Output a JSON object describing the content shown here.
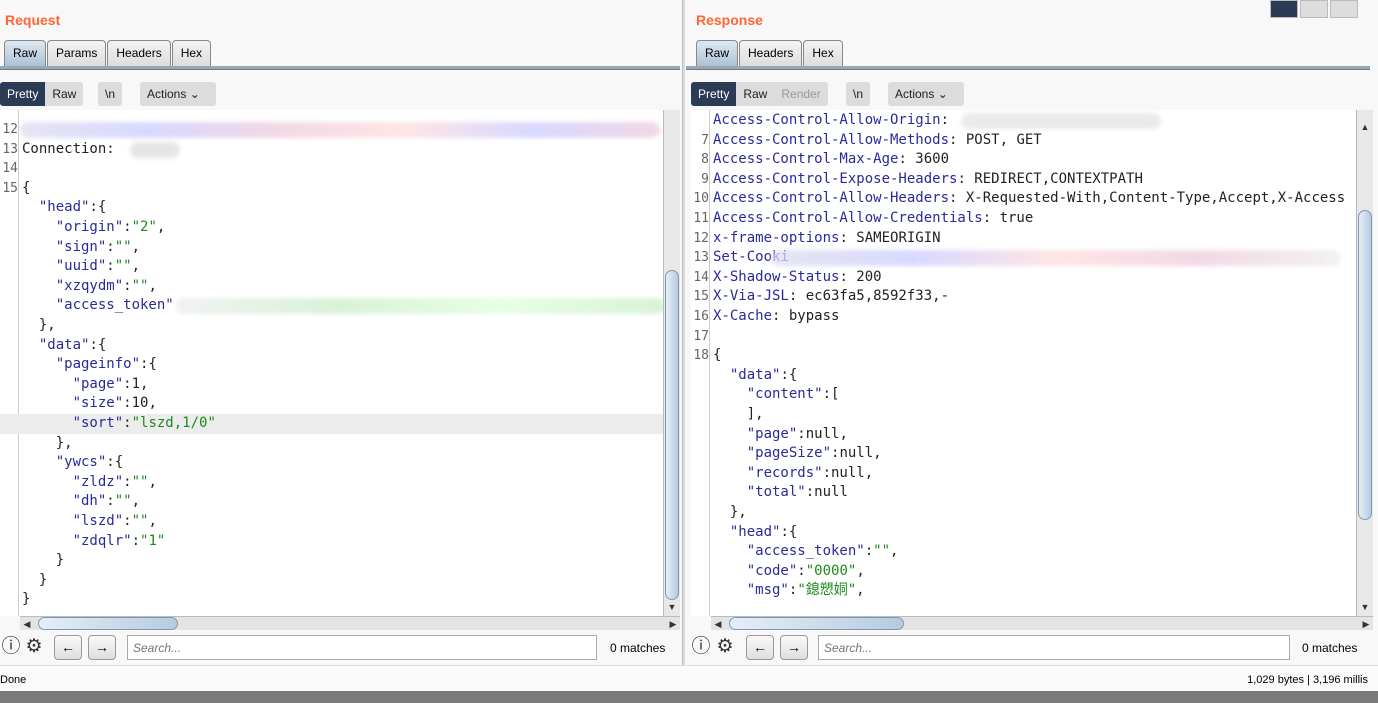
{
  "view_toggle": {
    "options": [
      "split-horizontal",
      "split-vertical",
      "tabs"
    ],
    "selected": "split-horizontal"
  },
  "request": {
    "title": "Request",
    "tabs": [
      "Raw",
      "Params",
      "Headers",
      "Hex"
    ],
    "active_tab": "Raw",
    "view_modes": [
      "Pretty",
      "Raw"
    ],
    "active_view": "Pretty",
    "newline_label": "\\n",
    "actions_label": "Actions",
    "lines": [
      {
        "n": "12",
        "segs": []
      },
      {
        "n": "13",
        "segs": [
          [
            "p",
            "Connection: "
          ]
        ]
      },
      {
        "n": "14",
        "segs": []
      },
      {
        "n": "15",
        "segs": [
          [
            "p",
            "{"
          ]
        ]
      },
      {
        "n": "",
        "segs": [
          [
            "p",
            "  "
          ],
          [
            "k",
            "\"head\""
          ],
          [
            "p",
            ":{"
          ]
        ]
      },
      {
        "n": "",
        "segs": [
          [
            "p",
            "    "
          ],
          [
            "k",
            "\"origin\""
          ],
          [
            "p",
            ":"
          ],
          [
            "s",
            "\"2\""
          ],
          [
            "p",
            ","
          ]
        ]
      },
      {
        "n": "",
        "segs": [
          [
            "p",
            "    "
          ],
          [
            "k",
            "\"sign\""
          ],
          [
            "p",
            ":"
          ],
          [
            "s",
            "\"\""
          ],
          [
            "p",
            ","
          ]
        ]
      },
      {
        "n": "",
        "segs": [
          [
            "p",
            "    "
          ],
          [
            "k",
            "\"uuid\""
          ],
          [
            "p",
            ":"
          ],
          [
            "s",
            "\"\""
          ],
          [
            "p",
            ","
          ]
        ]
      },
      {
        "n": "",
        "segs": [
          [
            "p",
            "    "
          ],
          [
            "k",
            "\"xzqydm\""
          ],
          [
            "p",
            ":"
          ],
          [
            "s",
            "\"\""
          ],
          [
            "p",
            ","
          ]
        ]
      },
      {
        "n": "",
        "segs": [
          [
            "p",
            "    "
          ],
          [
            "k",
            "\"access_token\""
          ]
        ]
      },
      {
        "n": "",
        "segs": [
          [
            "p",
            "  },"
          ]
        ]
      },
      {
        "n": "",
        "segs": [
          [
            "p",
            "  "
          ],
          [
            "k",
            "\"data\""
          ],
          [
            "p",
            ":{"
          ]
        ]
      },
      {
        "n": "",
        "segs": [
          [
            "p",
            "    "
          ],
          [
            "k",
            "\"pageinfo\""
          ],
          [
            "p",
            ":{"
          ]
        ]
      },
      {
        "n": "",
        "segs": [
          [
            "p",
            "      "
          ],
          [
            "k",
            "\"page\""
          ],
          [
            "p",
            ":1,"
          ]
        ]
      },
      {
        "n": "",
        "segs": [
          [
            "p",
            "      "
          ],
          [
            "k",
            "\"size\""
          ],
          [
            "p",
            ":10,"
          ]
        ]
      },
      {
        "n": "",
        "segs": [
          [
            "p",
            "      "
          ],
          [
            "k",
            "\"sort\""
          ],
          [
            "p",
            ":"
          ],
          [
            "s",
            "\"lszd,1/0\""
          ]
        ],
        "highlight": true
      },
      {
        "n": "",
        "segs": [
          [
            "p",
            "    },"
          ]
        ]
      },
      {
        "n": "",
        "segs": [
          [
            "p",
            "    "
          ],
          [
            "k",
            "\"ywcs\""
          ],
          [
            "p",
            ":{"
          ]
        ]
      },
      {
        "n": "",
        "segs": [
          [
            "p",
            "      "
          ],
          [
            "k",
            "\"zldz\""
          ],
          [
            "p",
            ":"
          ],
          [
            "s",
            "\"\""
          ],
          [
            "p",
            ","
          ]
        ]
      },
      {
        "n": "",
        "segs": [
          [
            "p",
            "      "
          ],
          [
            "k",
            "\"dh\""
          ],
          [
            "p",
            ":"
          ],
          [
            "s",
            "\"\""
          ],
          [
            "p",
            ","
          ]
        ]
      },
      {
        "n": "",
        "segs": [
          [
            "p",
            "      "
          ],
          [
            "k",
            "\"lszd\""
          ],
          [
            "p",
            ":"
          ],
          [
            "s",
            "\"\""
          ],
          [
            "p",
            ","
          ]
        ]
      },
      {
        "n": "",
        "segs": [
          [
            "p",
            "      "
          ],
          [
            "k",
            "\"zdqlr\""
          ],
          [
            "p",
            ":"
          ],
          [
            "s",
            "\"1\""
          ]
        ]
      },
      {
        "n": "",
        "segs": [
          [
            "p",
            "    }"
          ]
        ]
      },
      {
        "n": "",
        "segs": [
          [
            "p",
            "  }"
          ]
        ]
      },
      {
        "n": "",
        "segs": [
          [
            "p",
            "}"
          ]
        ]
      }
    ],
    "search_placeholder": "Search...",
    "matches": "0 matches"
  },
  "response": {
    "title": "Response",
    "tabs": [
      "Raw",
      "Headers",
      "Hex"
    ],
    "active_tab": "Raw",
    "view_modes": [
      "Pretty",
      "Raw",
      "Render"
    ],
    "active_view": "Pretty",
    "disabled_view": "Render",
    "newline_label": "\\n",
    "actions_label": "Actions",
    "lines": [
      {
        "n": "",
        "segs": [
          [
            "k",
            "Access-Control-Allow-Origin"
          ],
          [
            "p",
            ": "
          ]
        ]
      },
      {
        "n": "7",
        "segs": [
          [
            "k",
            "Access-Control-Allow-Methods"
          ],
          [
            "p",
            ": POST, GET"
          ]
        ]
      },
      {
        "n": "8",
        "segs": [
          [
            "k",
            "Access-Control-Max-Age"
          ],
          [
            "p",
            ": 3600"
          ]
        ]
      },
      {
        "n": "9",
        "segs": [
          [
            "k",
            "Access-Control-Expose-Headers"
          ],
          [
            "p",
            ": REDIRECT,CONTEXTPATH"
          ]
        ]
      },
      {
        "n": "10",
        "segs": [
          [
            "k",
            "Access-Control-Allow-Headers"
          ],
          [
            "p",
            ": X-Requested-With,Content-Type,Accept,X-Access"
          ]
        ]
      },
      {
        "n": "11",
        "segs": [
          [
            "k",
            "Access-Control-Allow-Credentials"
          ],
          [
            "p",
            ": true"
          ]
        ]
      },
      {
        "n": "12",
        "segs": [
          [
            "k",
            "x-frame-options"
          ],
          [
            "p",
            ": SAMEORIGIN"
          ]
        ]
      },
      {
        "n": "13",
        "segs": [
          [
            "k",
            "Set-Cooki"
          ]
        ]
      },
      {
        "n": "14",
        "segs": [
          [
            "k",
            "X-Shadow-Status"
          ],
          [
            "p",
            ": 200"
          ]
        ]
      },
      {
        "n": "15",
        "segs": [
          [
            "k",
            "X-Via-JSL"
          ],
          [
            "p",
            ": ec63fa5,8592f33,-"
          ]
        ]
      },
      {
        "n": "16",
        "segs": [
          [
            "k",
            "X-Cache"
          ],
          [
            "p",
            ": bypass"
          ]
        ]
      },
      {
        "n": "17",
        "segs": []
      },
      {
        "n": "18",
        "segs": [
          [
            "p",
            "{"
          ]
        ]
      },
      {
        "n": "",
        "segs": [
          [
            "p",
            "  "
          ],
          [
            "k",
            "\"data\""
          ],
          [
            "p",
            ":{"
          ]
        ]
      },
      {
        "n": "",
        "segs": [
          [
            "p",
            "    "
          ],
          [
            "k",
            "\"content\""
          ],
          [
            "p",
            ":["
          ]
        ]
      },
      {
        "n": "",
        "segs": [
          [
            "p",
            "    ],"
          ]
        ]
      },
      {
        "n": "",
        "segs": [
          [
            "p",
            "    "
          ],
          [
            "k",
            "\"page\""
          ],
          [
            "p",
            ":null,"
          ]
        ]
      },
      {
        "n": "",
        "segs": [
          [
            "p",
            "    "
          ],
          [
            "k",
            "\"pageSize\""
          ],
          [
            "p",
            ":null,"
          ]
        ]
      },
      {
        "n": "",
        "segs": [
          [
            "p",
            "    "
          ],
          [
            "k",
            "\"records\""
          ],
          [
            "p",
            ":null,"
          ]
        ]
      },
      {
        "n": "",
        "segs": [
          [
            "p",
            "    "
          ],
          [
            "k",
            "\"total\""
          ],
          [
            "p",
            ":null"
          ]
        ]
      },
      {
        "n": "",
        "segs": [
          [
            "p",
            "  },"
          ]
        ]
      },
      {
        "n": "",
        "segs": [
          [
            "p",
            "  "
          ],
          [
            "k",
            "\"head\""
          ],
          [
            "p",
            ":{"
          ]
        ]
      },
      {
        "n": "",
        "segs": [
          [
            "p",
            "    "
          ],
          [
            "k",
            "\"access_token\""
          ],
          [
            "p",
            ":"
          ],
          [
            "s",
            "\"\""
          ],
          [
            "p",
            ","
          ]
        ]
      },
      {
        "n": "",
        "segs": [
          [
            "p",
            "    "
          ],
          [
            "k",
            "\"code\""
          ],
          [
            "p",
            ":"
          ],
          [
            "s",
            "\"0000\""
          ],
          [
            "p",
            ","
          ]
        ]
      },
      {
        "n": "",
        "segs": [
          [
            "p",
            "    "
          ],
          [
            "k",
            "\"msg\""
          ],
          [
            "p",
            ":"
          ],
          [
            "s",
            "\"鎴愬姛\""
          ],
          [
            "p",
            ","
          ]
        ]
      }
    ],
    "search_placeholder": "Search...",
    "matches": "0 matches"
  },
  "status": {
    "left": "Done",
    "right": "1,029 bytes | 3,196 millis"
  }
}
